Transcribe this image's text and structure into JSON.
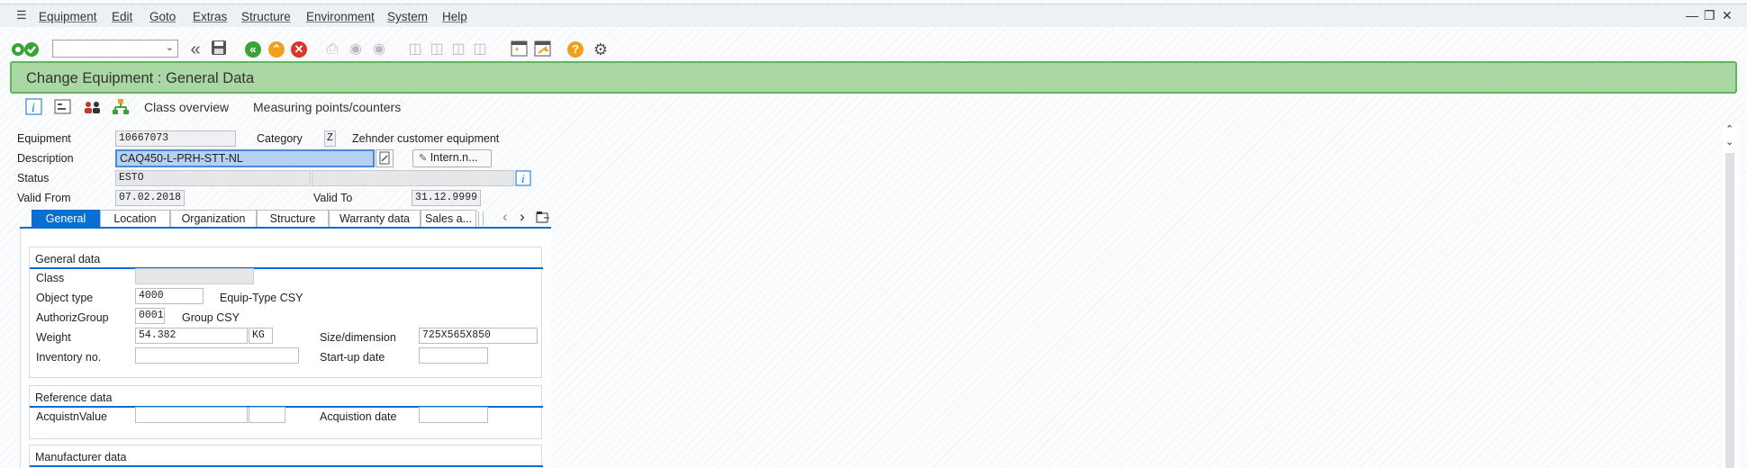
{
  "menubar": {
    "items": [
      "Equipment",
      "Edit",
      "Goto",
      "Extras",
      "Structure",
      "Environment",
      "System",
      "Help"
    ]
  },
  "window": {
    "minimize": "—",
    "restore": "❐",
    "close": "✕"
  },
  "icons": {
    "menu": "menu-icon",
    "enter": "enter-checkmark-icon",
    "back": "back-double-arrow-icon",
    "save": "save-disk-icon",
    "nav_back": "green-back-icon",
    "exit": "orange-exit-icon",
    "cancel": "red-cancel-icon",
    "print": "print-icon",
    "find": "binoculars-icon",
    "find_next": "find-next-icon",
    "first_page": "first-page-icon",
    "prev_page": "previous-page-icon",
    "next_page": "next-page-icon",
    "last_page": "last-page-icon",
    "new_session": "new-session-icon",
    "shortcut": "shortcut-icon",
    "help": "help-icon",
    "settings": "gear-icon"
  },
  "colors": {
    "title_bg": "#a9d8a4",
    "title_border": "#5fb75a",
    "accent": "#0a6ed1",
    "cancel": "#d9362b",
    "exit": "#f0a01e",
    "nav": "#3aa335"
  },
  "title": "Change Equipment : General Data",
  "app_toolbar": {
    "class_overview": "Class overview",
    "measuring_points": "Measuring points/counters"
  },
  "header": {
    "equipment_label": "Equipment",
    "equipment_value": "10667073",
    "category_label": "Category",
    "category_value": "Z",
    "category_text": "Zehnder customer equipment",
    "description_label": "Description",
    "description_value": "CAQ450-L-PRH-STT-NL",
    "intern_button": "Intern.n...",
    "status_label": "Status",
    "status_value": "ESTO",
    "status_value2": "",
    "valid_from_label": "Valid From",
    "valid_from_value": "07.02.2018",
    "valid_to_label": "Valid To",
    "valid_to_value": "31.12.9999"
  },
  "tabs": [
    "General",
    "Location",
    "Organization",
    "Structure",
    "Warranty data",
    "Sales a..."
  ],
  "tab_nav": {
    "prev": "‹",
    "next": "›"
  },
  "general_data": {
    "title": "General data",
    "class_label": "Class",
    "class_value": "",
    "object_type_label": "Object type",
    "object_type_value": "4000",
    "object_type_text": "Equip-Type CSY",
    "authoriz_label": "AuthorizGroup",
    "authoriz_value": "0001",
    "authoriz_text": "Group CSY",
    "weight_label": "Weight",
    "weight_value": "54.382",
    "weight_unit": "KG",
    "size_label": "Size/dimension",
    "size_value": "725X565X850",
    "inventory_label": "Inventory no.",
    "inventory_value": "",
    "startup_label": "Start-up date",
    "startup_value": ""
  },
  "reference_data": {
    "title": "Reference data",
    "acq_value_label": "AcquistnValue",
    "acq_value": "",
    "acq_currency": "",
    "acq_date_label": "Acquistion date",
    "acq_date": ""
  },
  "manufacturer_data": {
    "title": "Manufacturer data"
  }
}
